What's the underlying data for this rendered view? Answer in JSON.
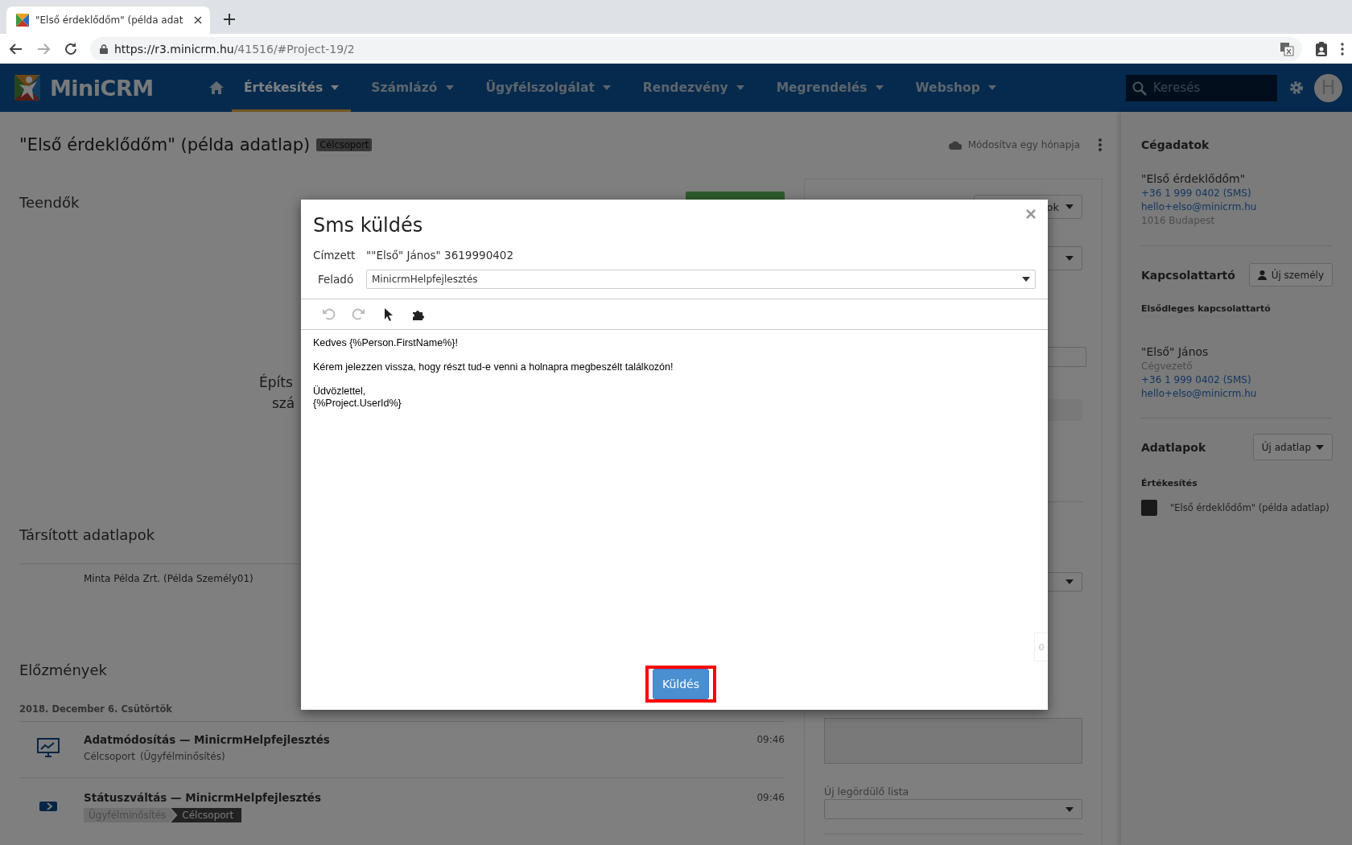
{
  "browser": {
    "tab_title": "\"Első érdeklődőm\" (példa adat",
    "url_host": "https://r3.minicrm.hu",
    "url_path": "/41516/#Project-19/2"
  },
  "nav": {
    "logo": "MiniCRM",
    "items": [
      {
        "label": "Értékesítés",
        "selected": true
      },
      {
        "label": "Számlázó",
        "selected": false
      },
      {
        "label": "Ügyfélszolgálat",
        "selected": false
      },
      {
        "label": "Rendezvény",
        "selected": false
      },
      {
        "label": "Megrendelés",
        "selected": false
      },
      {
        "label": "Webshop",
        "selected": false
      }
    ],
    "search": {
      "placeholder": "Keresés"
    },
    "avatar": "H"
  },
  "page": {
    "title": "\"Első érdeklődőm\" (példa adatlap)",
    "badge": "Célcsoport",
    "modified": "Módosítva egy hónapja",
    "todos": {
      "title": "Teendők",
      "empty_lines": [
        "Építs",
        "szá"
      ]
    },
    "linked": {
      "title": "Társított adatlapok",
      "items": [
        "Minta Példa Zrt. (Példa Személy01)"
      ]
    },
    "history": {
      "title": "Előzmények",
      "date": "2018. December 6. Csütörtök",
      "entries": [
        {
          "kind": "data_change",
          "title": "Adatmódosítás — MinicrmHelpfejlesztés",
          "subtitle": [
            "Célcsoport",
            "(Ügyfélminősítés)"
          ],
          "time": "09:46"
        },
        {
          "kind": "status_change",
          "title": "Státuszváltás — MinicrmHelpfejlesztés",
          "from": "Ügyfélminősítés",
          "to": "Célcsoport",
          "time": "09:46"
        }
      ]
    }
  },
  "panel": {
    "button": "ok",
    "dropdown_label": "Új legördülő lista"
  },
  "sidebar": {
    "company": {
      "title": "Cégadatok",
      "name": "\"Első érdeklődőm\"",
      "phone": "+36 1 999 0402 (SMS)",
      "email": "hello+elso@minicrm.hu",
      "address": "1016 Budapest"
    },
    "contact": {
      "title": "Kapcsolattartó",
      "button": "Új személy",
      "subtitle": "Elsődleges kapcsolattartó",
      "name": "\"Első\" János",
      "role": "Cégvezető",
      "phone": "+36 1 999 0402 (SMS)",
      "email": "hello+elso@minicrm.hu"
    },
    "datasheets": {
      "title": "Adatlapok",
      "button": "Új adatlap",
      "group": "Értékesítés",
      "items": [
        "\"Első érdeklődőm\" (példa adatlap)"
      ]
    }
  },
  "modal": {
    "title": "Sms küldés",
    "recipient_label": "Címzett",
    "recipient": "\"\"Első\" János\" 3619990402",
    "sender_label": "Feladó",
    "sender": "MinicrmHelpfejlesztés",
    "toolbar": [
      {
        "kind": "undo",
        "disabled": true
      },
      {
        "kind": "redo",
        "disabled": true
      },
      {
        "kind": "cursor",
        "disabled": false
      },
      {
        "kind": "puzzle",
        "disabled": false
      }
    ],
    "body": [
      [
        "Kedves {%Person.FirstName%}!"
      ],
      [
        "Kérem jelezzen vissza, hogy részt tud-e venni a holnapra megbeszélt találkozón!"
      ],
      [
        "Üdvözlettel,",
        "{%Project.UserId%}"
      ]
    ],
    "counter": "0",
    "send_button": {
      "label": "Küldés",
      "highlighted": true
    }
  }
}
